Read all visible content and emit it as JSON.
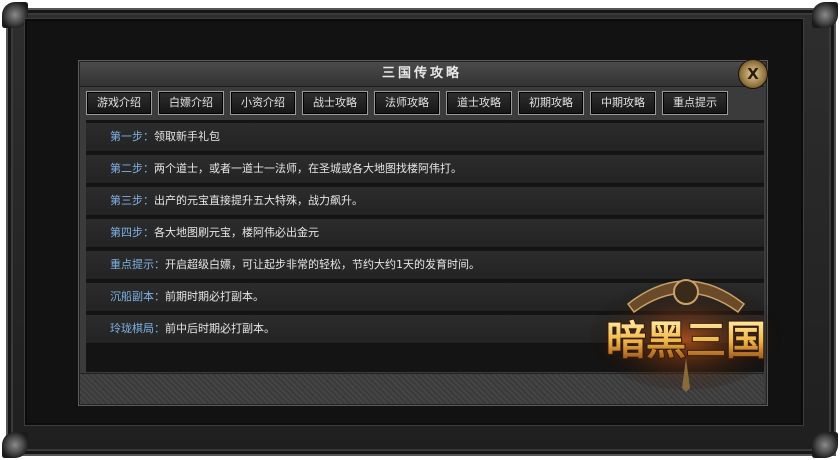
{
  "window": {
    "title": "三国传攻略",
    "close_label": "X"
  },
  "tabs": [
    {
      "label": "游戏介绍"
    },
    {
      "label": "白嫖介绍"
    },
    {
      "label": "小资介绍"
    },
    {
      "label": "战士攻略"
    },
    {
      "label": "法师攻略"
    },
    {
      "label": "道士攻略"
    },
    {
      "label": "初期攻略"
    },
    {
      "label": "中期攻略"
    },
    {
      "label": "重点提示"
    }
  ],
  "rows": [
    {
      "key": "第一步：",
      "text": "领取新手礼包"
    },
    {
      "key": "第二步：",
      "text": "两个道士，或者一道士一法师，在圣城或各大地图找楼阿伟打。"
    },
    {
      "key": "第三步：",
      "text": "出产的元宝直接提升五大特殊，战力飙升。"
    },
    {
      "key": "第四步：",
      "text": "各大地图刷元宝，楼阿伟必出金元"
    },
    {
      "key": "重点提示：",
      "text": "开启超级白嫖，可让起步非常的轻松，节约大约1天的发育时间。"
    },
    {
      "key": "沉船副本：",
      "text": "前期时期必打副本。"
    },
    {
      "key": "玲珑棋局：",
      "text": "前中后时期必打副本。"
    }
  ],
  "logo": {
    "text": "暗黑三国"
  },
  "colors": {
    "key_text": "#7fb2e5",
    "body_text": "#e6e6e6",
    "logo_gold": "#f0b84a"
  }
}
